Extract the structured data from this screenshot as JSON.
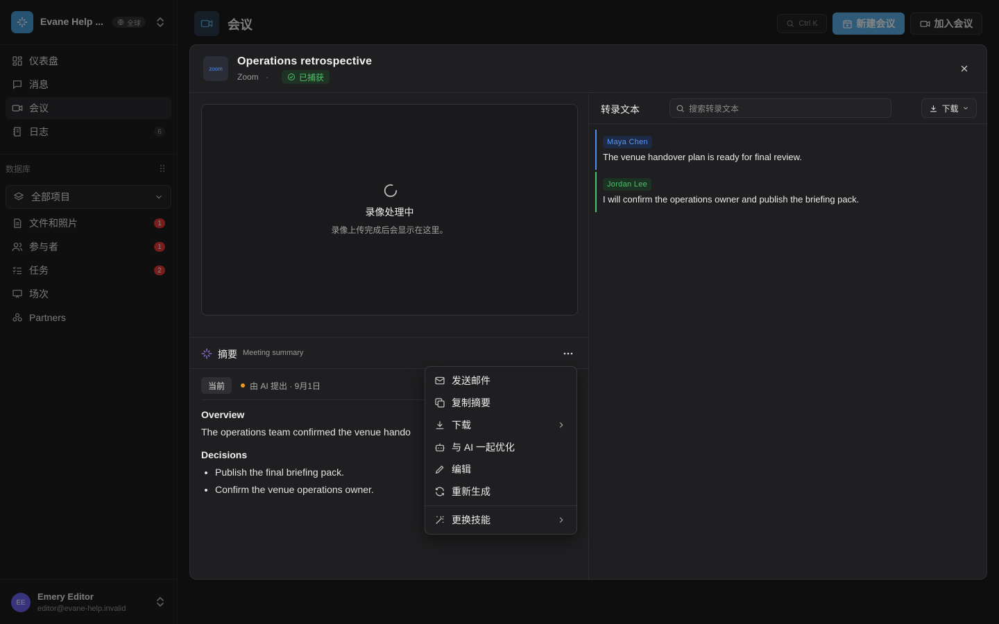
{
  "workspace": {
    "name": "Evane Help ...",
    "scope_badge": "全球",
    "icon": "sparkle-icon"
  },
  "sidebar": {
    "nav": [
      {
        "label": "仪表盘",
        "icon": "dashboard-icon",
        "count": ""
      },
      {
        "label": "消息",
        "icon": "message-icon",
        "count": ""
      },
      {
        "label": "会议",
        "icon": "video-icon",
        "count": "",
        "active": true
      },
      {
        "label": "日志",
        "icon": "log-icon",
        "count": "6"
      }
    ],
    "section_label": "数据库",
    "select_value": "全部项目",
    "db_items": [
      {
        "label": "文件和照片",
        "icon": "file-icon",
        "count": "1"
      },
      {
        "label": "参与者",
        "icon": "users-icon",
        "count": "1"
      },
      {
        "label": "任务",
        "icon": "tasks-icon",
        "count": "2"
      },
      {
        "label": "场次",
        "icon": "session-icon",
        "count": ""
      },
      {
        "label": "Partners",
        "icon": "partners-icon",
        "count": ""
      }
    ]
  },
  "user": {
    "initials": "EE",
    "name": "Emery Editor",
    "email": "editor@evane-help.invalid"
  },
  "header": {
    "title": "会议",
    "shortcut": "Ctrl K",
    "new_meeting": "新建会议",
    "join_meeting": "加入会议"
  },
  "modal": {
    "logo_text": "zoom",
    "title": "Operations retrospective",
    "source": "Zoom",
    "separator": "·",
    "status": "已捕获",
    "video": {
      "title": "录像处理中",
      "subtitle": "录像上传完成后会显示在这里。"
    },
    "summary": {
      "title": "摘要",
      "subtitle": "Meeting summary",
      "version_tag": "当前",
      "version_meta": "由 AI 提出 · 9月1日",
      "overview_heading": "Overview",
      "overview_text": "The operations team confirmed the venue hando",
      "decisions_heading": "Decisions",
      "decisions": [
        "Publish the final briefing pack.",
        "Confirm the venue operations owner."
      ]
    },
    "transcript": {
      "title": "转录文本",
      "search_placeholder": "搜索转录文本",
      "download": "下载",
      "segments": [
        {
          "speaker": "Maya Chen",
          "text": "The venue handover plan is ready for final review.",
          "color": "#4d8cf5"
        },
        {
          "speaker": "Jordan Lee",
          "text": "I will confirm the operations owner and publish the briefing pack.",
          "color": "#4fc26a"
        }
      ]
    }
  },
  "menu": {
    "items": [
      {
        "label": "发送邮件",
        "icon": "mail-icon"
      },
      {
        "label": "复制摘要",
        "icon": "copy-icon"
      },
      {
        "label": "下载",
        "icon": "download-icon",
        "submenu": true
      },
      {
        "label": "与 AI 一起优化",
        "icon": "bot-icon"
      },
      {
        "label": "编辑",
        "icon": "pencil-icon"
      },
      {
        "label": "重新生成",
        "icon": "refresh-icon"
      },
      {
        "label": "更换技能",
        "icon": "wand-icon",
        "submenu": true
      }
    ]
  }
}
